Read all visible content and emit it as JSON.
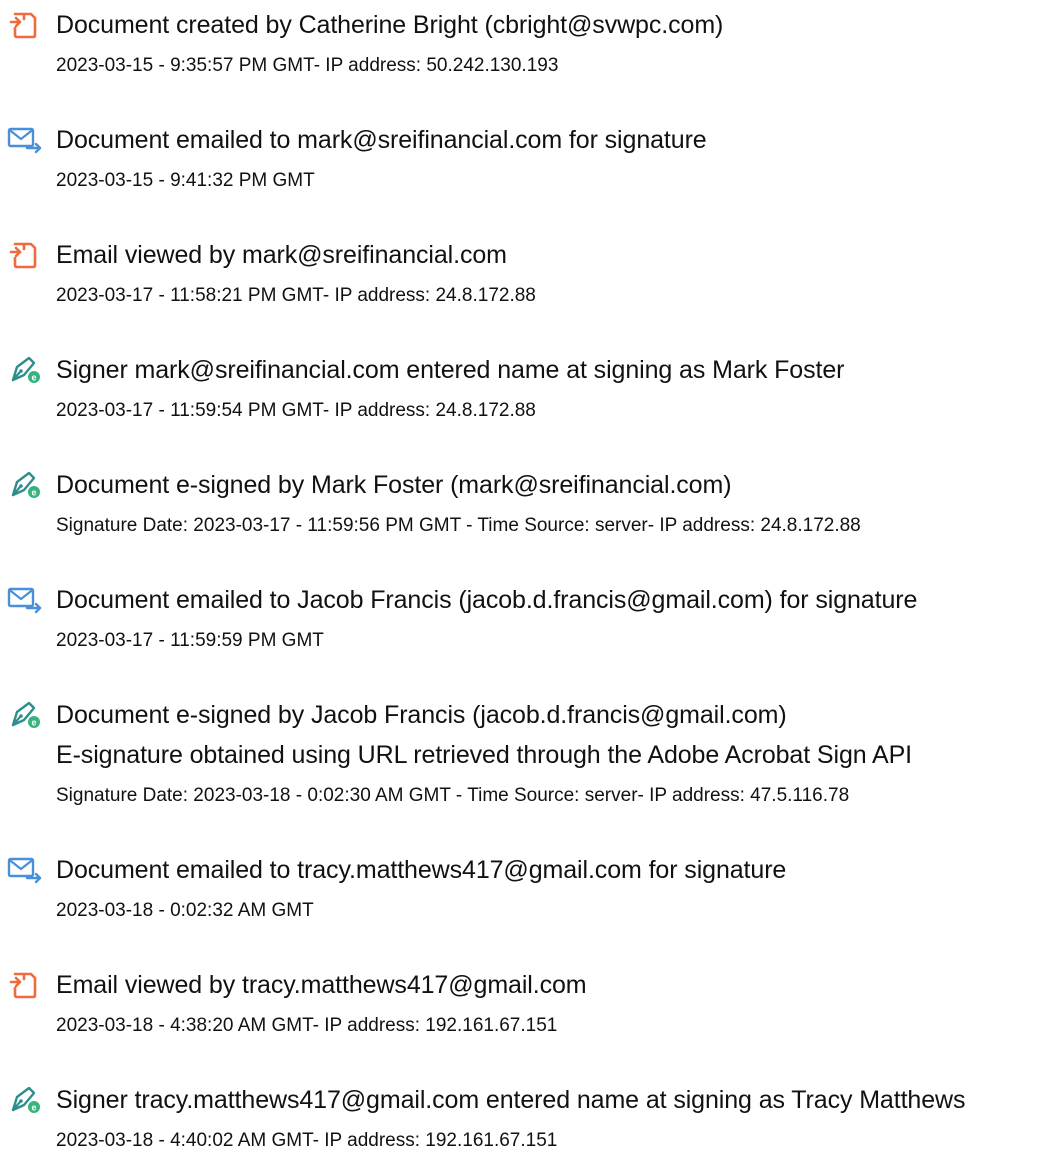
{
  "events": [
    {
      "icon": "document-created-icon",
      "title": "Document created by Catherine Bright (cbright@svwpc.com)",
      "meta": "2023-03-15 - 9:35:57 PM GMT- IP address: 50.242.130.193"
    },
    {
      "icon": "email-sent-icon",
      "title": "Document emailed to mark@sreifinancial.com for signature",
      "meta": "2023-03-15 - 9:41:32 PM GMT"
    },
    {
      "icon": "email-viewed-icon",
      "title": "Email viewed by mark@sreifinancial.com",
      "meta": "2023-03-17 - 11:58:21 PM GMT- IP address: 24.8.172.88"
    },
    {
      "icon": "signature-pen-icon",
      "title": "Signer mark@sreifinancial.com entered name at signing as Mark Foster",
      "meta": "2023-03-17 - 11:59:54 PM GMT- IP address: 24.8.172.88"
    },
    {
      "icon": "signature-pen-icon",
      "title": "Document e-signed by Mark Foster (mark@sreifinancial.com)",
      "meta": "Signature Date: 2023-03-17 - 11:59:56 PM GMT - Time Source: server- IP address: 24.8.172.88"
    },
    {
      "icon": "email-sent-icon",
      "title": "Document emailed to Jacob Francis (jacob.d.francis@gmail.com) for signature",
      "meta": "2023-03-17 - 11:59:59 PM GMT"
    },
    {
      "icon": "signature-pen-icon",
      "title": "Document e-signed by Jacob Francis (jacob.d.francis@gmail.com)",
      "subtitle": "E-signature obtained using URL retrieved through the Adobe Acrobat Sign API",
      "meta": "Signature Date: 2023-03-18 - 0:02:30 AM GMT - Time Source: server- IP address: 47.5.116.78"
    },
    {
      "icon": "email-sent-icon",
      "title": "Document emailed to tracy.matthews417@gmail.com for signature",
      "meta": "2023-03-18 - 0:02:32 AM GMT"
    },
    {
      "icon": "email-viewed-icon",
      "title": "Email viewed by tracy.matthews417@gmail.com",
      "meta": "2023-03-18 - 4:38:20 AM GMT- IP address: 192.161.67.151"
    },
    {
      "icon": "signature-pen-icon",
      "title": "Signer tracy.matthews417@gmail.com entered name at signing as Tracy Matthews",
      "meta": "2023-03-18 - 4:40:02 AM GMT- IP address: 192.161.67.151"
    }
  ],
  "colors": {
    "document_icon": "#ef6a3c",
    "email_icon": "#4a90d9",
    "signature_icon": "#2c8f8c",
    "signature_badge": "#36b37e"
  }
}
